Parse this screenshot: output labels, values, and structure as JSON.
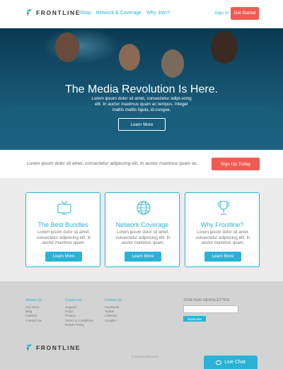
{
  "header": {
    "brand": "FRONTLINE",
    "nav": [
      "Shop",
      "Network & Coverage",
      "Why Join?"
    ],
    "sign_in": "Sign In",
    "get_started": "Get Started"
  },
  "hero": {
    "title": "The Media Revolution Is Here.",
    "subtitle": "Lorem ipsum dolor sit amet, consectetur adipi-scing elit. In auctor maximus quam ac tempus. Integer mattis mattis ligula, id congue.",
    "button": "Learn More"
  },
  "strip": {
    "text": "Lorem ipsum dolor sit amet, consectetur adipiscing elit. In auctor maximus quam ac.",
    "button": "Sign Up Today"
  },
  "features": [
    {
      "icon": "tv-icon",
      "title": "The Best Bundles",
      "text": "Lorem ipsum dolor sit amet, consectetur adipiscing elit. In auctor maximus quam.",
      "button": "Learn More"
    },
    {
      "icon": "globe-icon",
      "title": "Network Coverage",
      "text": "Lorem ipsum dolor sit amet, consectetur adipiscing elit. In auctor maximus quam.",
      "button": "Learn More"
    },
    {
      "icon": "trophy-icon",
      "title": "Why Frontline?",
      "text": "Lorem ipsum dolor sit amet, consectetur adipiscing elit. In auctor maximus quam.",
      "button": "Learn More"
    }
  ],
  "footer": {
    "columns": [
      {
        "heading": "About Us",
        "items": [
          "Our Story",
          "Blog",
          "Careers",
          "Contact Us"
        ]
      },
      {
        "heading": "Customer",
        "items": [
          "Support",
          "FAQs",
          "Privacy",
          "Terms & Conditions",
          "Return Policy"
        ]
      },
      {
        "heading": "Follow Us",
        "items": [
          "Facebook",
          "Twitter",
          "LinkedIn",
          "Google+"
        ]
      }
    ],
    "newsletter_heading": "JOIN OUR NEWSLETTER",
    "subscribe": "Subscribe",
    "brand": "FRONTLINE",
    "copyright": "© 2016 Frontline Inc."
  },
  "chat": {
    "label": "Live Chat"
  },
  "colors": {
    "accent": "#2bb3d6",
    "cta": "#ef5b52"
  }
}
